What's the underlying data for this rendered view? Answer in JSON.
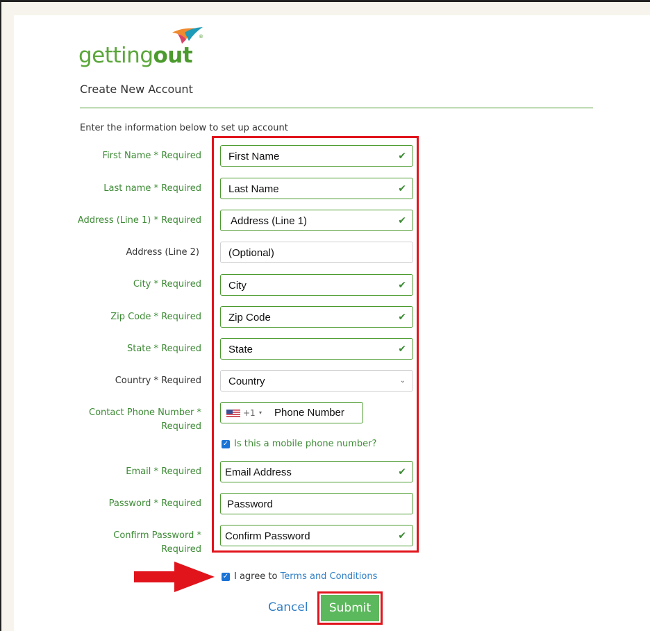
{
  "logo": {
    "prefix": "getting",
    "suffix": "out",
    "registered": "®"
  },
  "page_title": "Create New Account",
  "intro": "Enter the information below to set up account",
  "fields": [
    {
      "label": "First Name * Required",
      "value": "First Name",
      "valid": true
    },
    {
      "label": "Last name * Required",
      "value": "Last Name",
      "valid": true
    },
    {
      "label": "Address (Line 1) * Required",
      "value": "Address (Line 1)",
      "valid": true
    },
    {
      "label": "Address (Line 2)",
      "value": "(Optional)",
      "valid": false
    },
    {
      "label": "City * Required",
      "value": "City",
      "valid": true
    },
    {
      "label": "Zip Code * Required",
      "value": "Zip Code",
      "valid": true
    },
    {
      "label": "State * Required",
      "value": "State",
      "valid": true
    },
    {
      "label": "Country * Required",
      "value": "Country",
      "valid": false
    }
  ],
  "phone": {
    "label_line1": "Contact Phone Number *",
    "label_line2": "Required",
    "dial_code": "+1",
    "value": "Phone Number",
    "mobile_label": "Is this a mobile phone number?",
    "mobile_checked": true
  },
  "email": {
    "label": "Email * Required",
    "value": "Email Address",
    "valid": true
  },
  "password": {
    "label": "Password * Required",
    "value": "Password",
    "valid": false
  },
  "confirm_password": {
    "label_line1": "Confirm Password *",
    "label_line2": "Required",
    "value": "Confirm Password",
    "valid": true
  },
  "terms": {
    "prefix": "I agree to ",
    "link": "Terms and Conditions",
    "checked": true
  },
  "actions": {
    "cancel": "Cancel",
    "submit": "Submit"
  },
  "glyphs": {
    "check": "✔",
    "chevron": "⌄",
    "small_chevron": "▾",
    "checkbox": "✓"
  },
  "colors": {
    "brand_green": "#4b9a2e",
    "label_green": "#3d8b35",
    "submit_green": "#5cb85c",
    "link_blue": "#2f7fc6",
    "annotation_red": "#e1141c"
  }
}
